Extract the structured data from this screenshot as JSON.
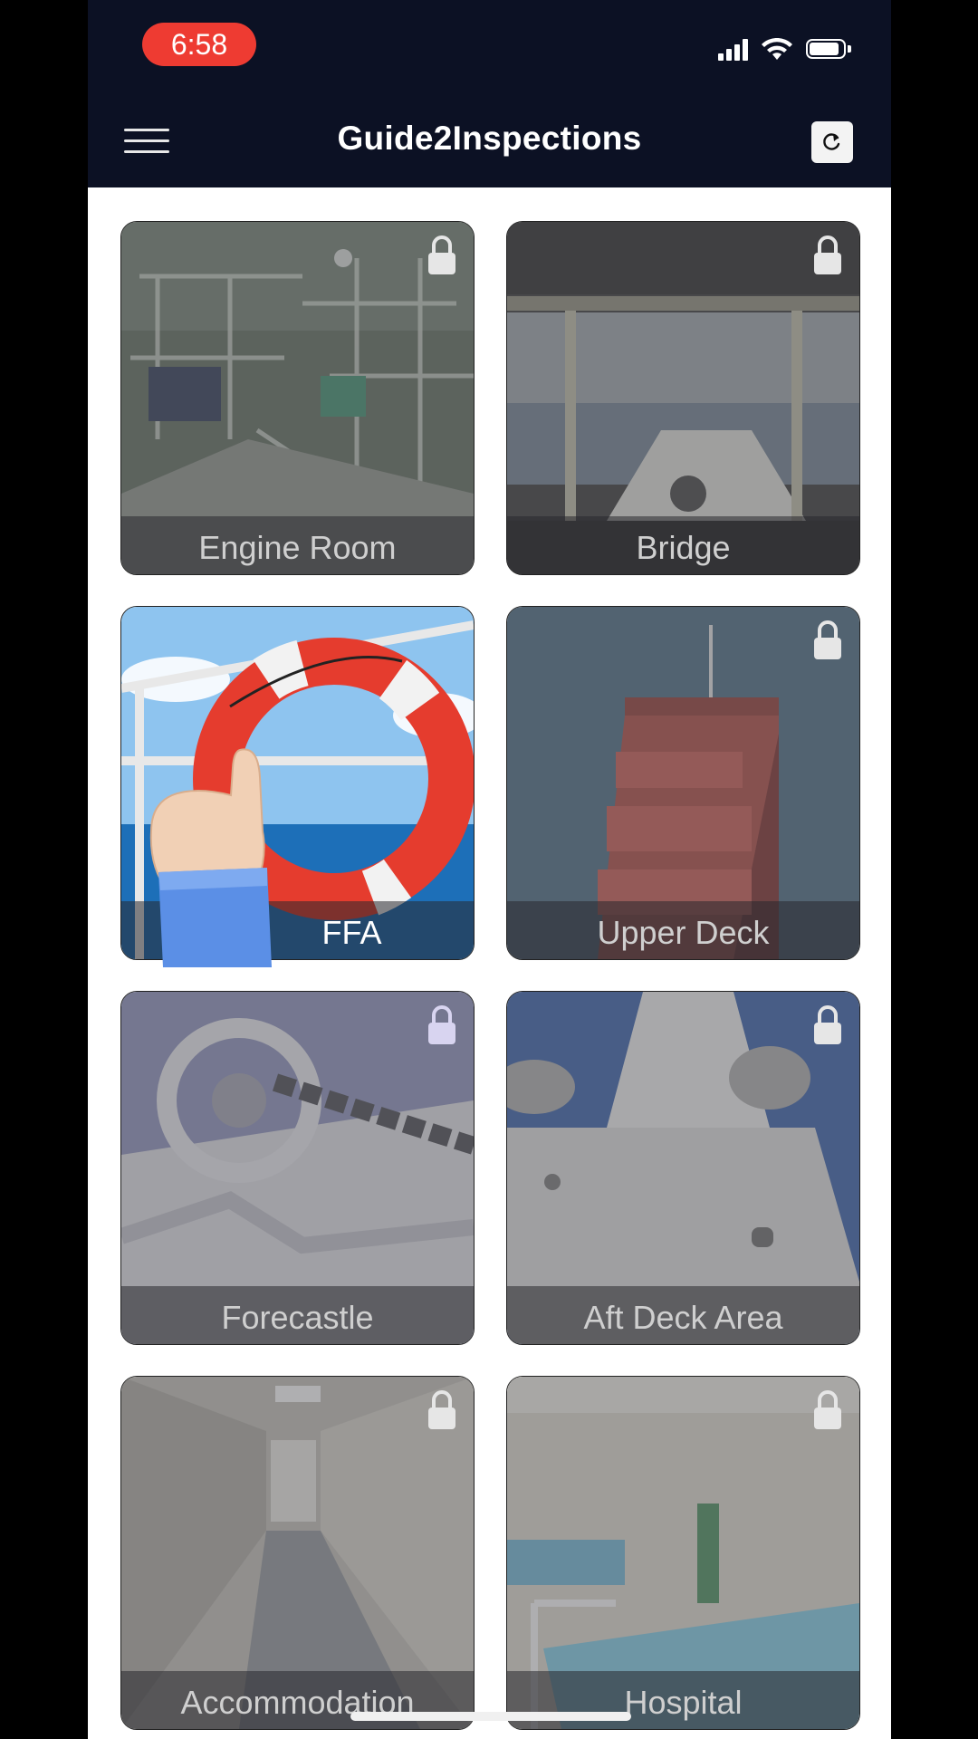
{
  "status_bar": {
    "time": "6:58",
    "time_pill_color": "#ee3b32"
  },
  "app_bar": {
    "title": "Guide2Inspections",
    "menu_icon": "hamburger-menu-icon",
    "refresh_icon": "refresh-icon",
    "background": "#0c1124"
  },
  "categories": [
    {
      "label": "Engine Room",
      "locked": true,
      "scene": "engine-room-photo"
    },
    {
      "label": "Bridge",
      "locked": true,
      "scene": "bridge-photo"
    },
    {
      "label": "FFA",
      "locked": false,
      "scene": "lifebuoy-photo"
    },
    {
      "label": "Upper Deck",
      "locked": true,
      "scene": "cargo-ship-photo"
    },
    {
      "label": "Forecastle",
      "locked": true,
      "scene": "windlass-photo"
    },
    {
      "label": "Aft Deck Area",
      "locked": true,
      "scene": "funnel-photo"
    },
    {
      "label": "Accommodation",
      "locked": true,
      "scene": "corridor-photo"
    },
    {
      "label": "Hospital",
      "locked": true,
      "scene": "hospital-photo"
    }
  ]
}
